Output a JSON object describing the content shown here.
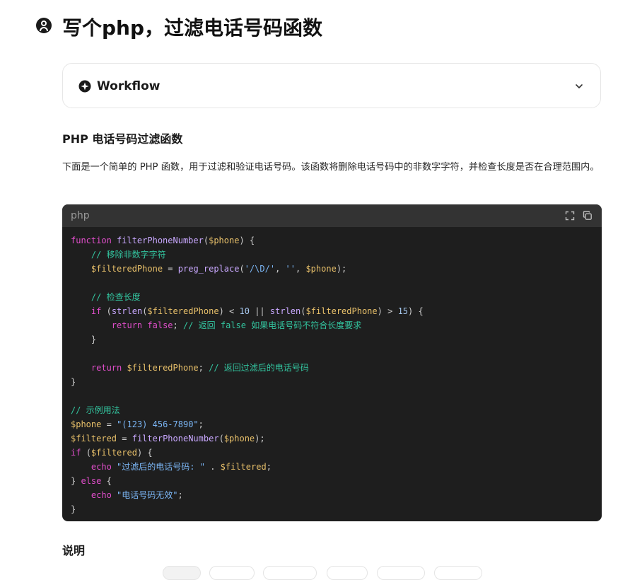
{
  "header": {
    "title": "写个php，过滤电话号码函数",
    "user_icon": "user-icon"
  },
  "workflow": {
    "label": "Workflow",
    "icon": "workflow-icon",
    "expand_icon": "chevron-down-icon"
  },
  "content": {
    "heading": "PHP 电话号码过滤函数",
    "intro": "下面是一个简单的 PHP 函数，用于过滤和验证电话号码。该函数将删除电话号码中的非数字字符，并检查长度是否在合理范围内。",
    "explain_heading": "说明"
  },
  "code_block": {
    "language": "php",
    "lines": [
      "function filterPhoneNumber($phone) {",
      "    // 移除非数字字符",
      "    $filteredPhone = preg_replace('/\\D/', '', $phone);",
      "",
      "    // 检查长度",
      "    if (strlen($filteredPhone) < 10 || strlen($filteredPhone) > 15) {",
      "        return false; // 返回 false 如果电话号码不符合长度要求",
      "    }",
      "",
      "    return $filteredPhone; // 返回过滤后的电话号码",
      "}",
      "",
      "// 示例用法",
      "$phone = \"(123) 456-7890\";",
      "$filtered = filterPhoneNumber($phone);",
      "if ($filtered) {",
      "    echo \"过滤后的电话号码: \" . $filtered;",
      "} else {",
      "    echo \"电话号码无效\";",
      "}"
    ]
  },
  "colors": {
    "code_bg": "#1e1e1e",
    "code_header_bg": "#333333",
    "keyword": "#e14ecb",
    "function": "#c9a8ff",
    "variable": "#e8c06a",
    "string": "#7bb6f5",
    "comment": "#33c6a0"
  }
}
